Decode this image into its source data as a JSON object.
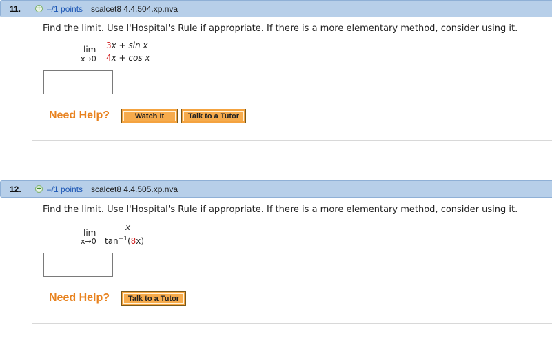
{
  "questions": [
    {
      "number": "11.",
      "plus_icon": "+",
      "points": "–/1 points",
      "source": "scalcet8 4.4.504.xp.nva",
      "prompt": "Find the limit. Use l'Hospital's Rule if appropriate. If there is a more elementary method, consider using it.",
      "lim": "lim",
      "lim_sub": "x→0",
      "numerator": {
        "a": "3",
        "b": "x + sin x"
      },
      "denominator": {
        "a": "4",
        "b": "x + cos x"
      },
      "need_help": "Need Help?",
      "buttons": [
        "Watch It",
        "Talk to a Tutor"
      ]
    },
    {
      "number": "12.",
      "plus_icon": "+",
      "points": "–/1 points",
      "source": "scalcet8 4.4.505.xp.nva",
      "prompt": "Find the limit. Use l'Hospital's Rule if appropriate. If there is a more elementary method, consider using it.",
      "lim": "lim",
      "lim_sub": "x→0",
      "numerator": {
        "a": "x"
      },
      "denominator": {
        "a": "tan",
        "sup": "−1",
        "b": "(",
        "c": "8",
        "d": "x)"
      },
      "need_help": "Need Help?",
      "buttons": [
        "Talk to a Tutor"
      ]
    }
  ],
  "colors": {
    "header_bg": "#b7cfe9",
    "points": "#1d57b5",
    "need_help": "#e8821e",
    "button": "#f4a340",
    "red_coef": "#d12020"
  }
}
